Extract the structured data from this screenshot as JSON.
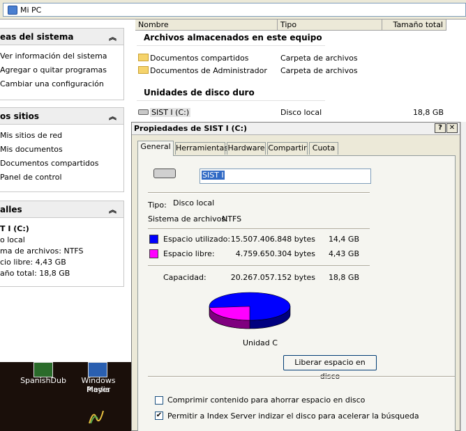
{
  "address": {
    "text": "Mi PC"
  },
  "left_panel": {
    "system_tasks": {
      "title": "eas del sistema",
      "items": [
        "Ver información del sistema",
        "Agregar o quitar programas",
        "Cambiar una configuración"
      ]
    },
    "other_places": {
      "title": "os sitios",
      "items": [
        "Mis sitios de red",
        "Mis documentos",
        "Documentos compartidos",
        "Panel de control"
      ]
    },
    "details": {
      "title": "alles",
      "drive_name": "T I (C:)",
      "lines": [
        "o local",
        "ma de archivos: NTFS",
        "cio libre: 4,43 GB",
        "año total: 18,8 GB"
      ]
    }
  },
  "file_list": {
    "columns": [
      "Nombre",
      "Tipo",
      "Tamaño total"
    ],
    "group_files": "Archivos almacenados en este equipo",
    "files": [
      {
        "name": "Documentos compartidos",
        "type": "Carpeta de archivos"
      },
      {
        "name": "Documentos de Administrador",
        "type": "Carpeta de archivos"
      }
    ],
    "group_drives": "Unidades de disco duro",
    "drives": [
      {
        "name": "SIST I (C:)",
        "type": "Disco local",
        "size": "18,8 GB"
      }
    ]
  },
  "desktop": {
    "icons": [
      "SpanishDub",
      "Windows Media",
      "Player"
    ]
  },
  "dialog": {
    "title": "Propiedades de SIST I (C:)",
    "help": "?",
    "close": "✕",
    "tabs": [
      "General",
      "Herramientas",
      "Hardware",
      "Compartir",
      "Cuota"
    ],
    "volume_name": "SIST I",
    "type_label": "Tipo:",
    "type_value": "Disco local",
    "fs_label": "Sistema de archivos:",
    "fs_value": "NTFS",
    "used_label": "Espacio utilizado:",
    "used_bytes": "15.507.406.848 bytes",
    "used_gb": "14,4 GB",
    "free_label": "Espacio libre:",
    "free_bytes": "4.759.650.304 bytes",
    "free_gb": "4,43 GB",
    "cap_label": "Capacidad:",
    "cap_bytes": "20.267.057.152 bytes",
    "cap_gb": "18,8 GB",
    "disk_label": "Unidad C",
    "cleanup_button": "Liberar espacio en disco",
    "compress_label": "Comprimir contenido para ahorrar espacio en disco",
    "compress_checked": false,
    "index_label": "Permitir a Index Server indizar el disco para acelerar la búsqueda",
    "index_checked": true,
    "used_fraction": 0.765,
    "colors": {
      "used": "#0000ff",
      "free": "#ff00ff"
    }
  }
}
